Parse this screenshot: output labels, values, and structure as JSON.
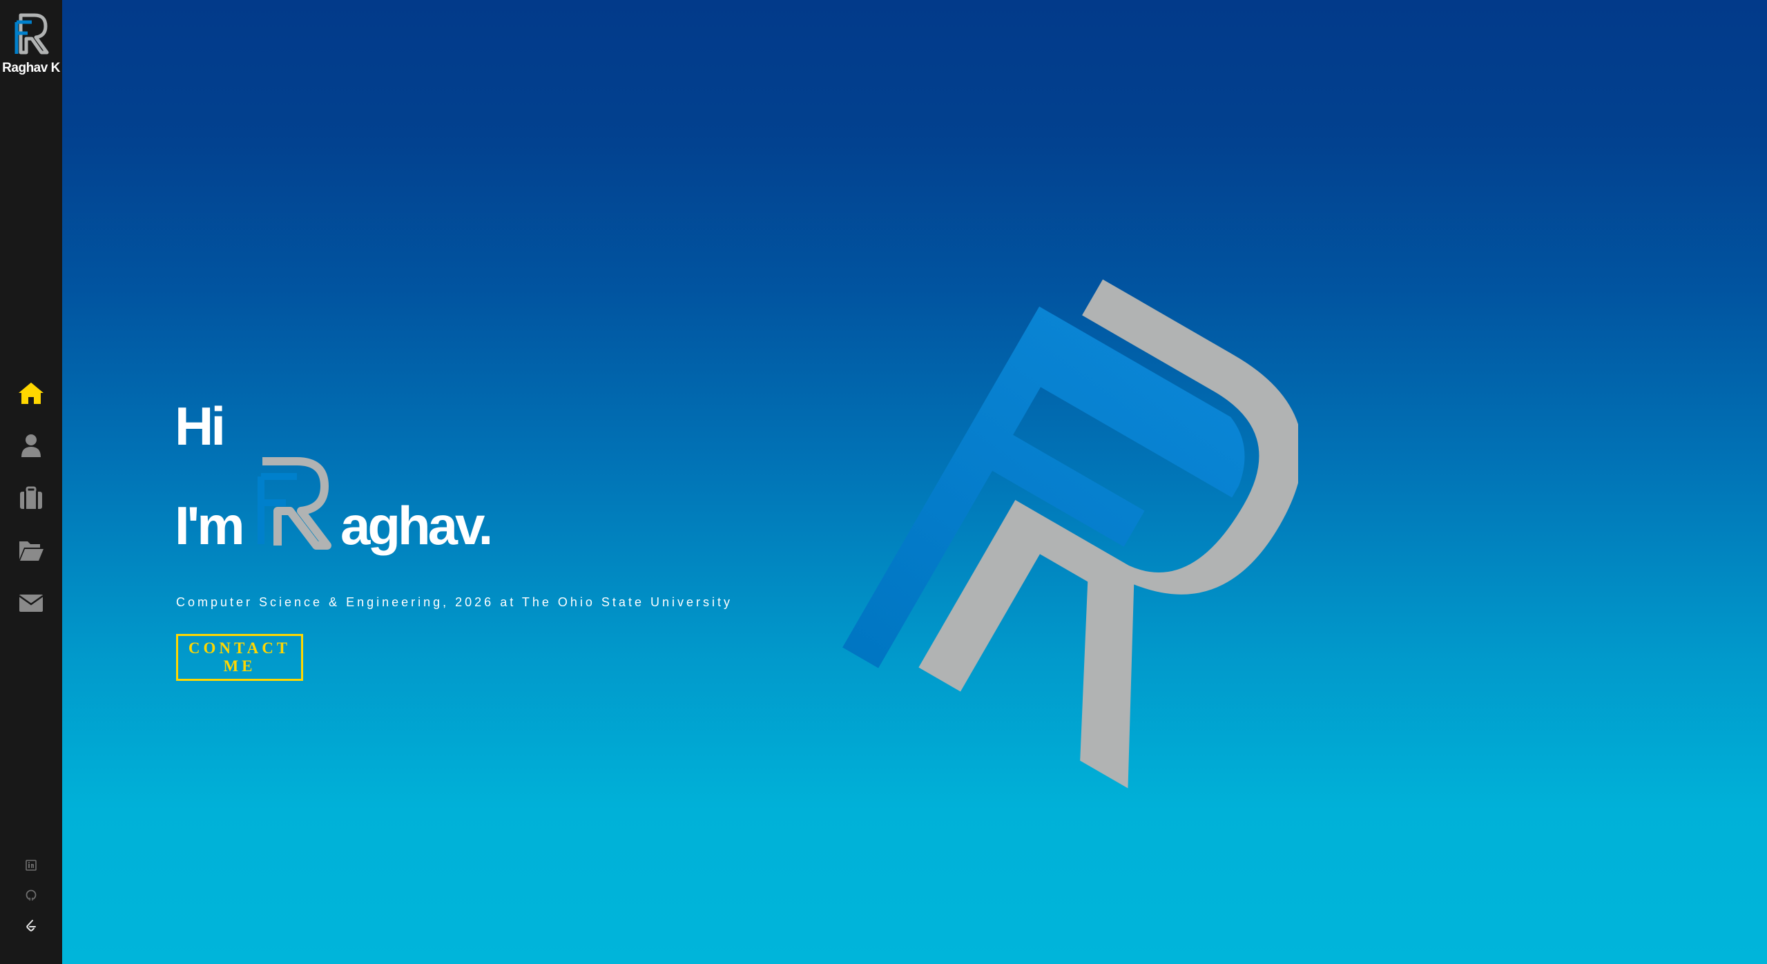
{
  "sidebar": {
    "brand_name": "Raghav K",
    "logo_icon": "rk-monogram-logo",
    "nav": [
      {
        "name": "home",
        "icon": "home-icon",
        "active": true
      },
      {
        "name": "about",
        "icon": "user-icon",
        "active": false
      },
      {
        "name": "experience",
        "icon": "briefcase-icon",
        "active": false
      },
      {
        "name": "projects",
        "icon": "folder-open-icon",
        "active": false
      },
      {
        "name": "contact",
        "icon": "envelope-icon",
        "active": false
      }
    ],
    "social": [
      {
        "name": "linkedin",
        "icon": "linkedin-icon"
      },
      {
        "name": "github",
        "icon": "github-icon"
      },
      {
        "name": "leetcode",
        "icon": "leetcode-icon"
      }
    ],
    "colors": {
      "background": "#181818",
      "active_icon": "#ffd700",
      "inactive_icon": "#8a8a8a"
    }
  },
  "hero": {
    "greeting": "Hi",
    "im": "I'm",
    "name_rest": "aghav.",
    "subtitle": "Computer Science & Engineering, 2026 at The Ohio State University",
    "contact_label": "CONTACT ME",
    "colors": {
      "gradient_top": "#023a8a",
      "gradient_bottom": "#00b5da",
      "text": "#ffffff",
      "accent": "#ffd700",
      "logo_blue": "#0080cc",
      "logo_grey": "#b1b3b3"
    }
  }
}
